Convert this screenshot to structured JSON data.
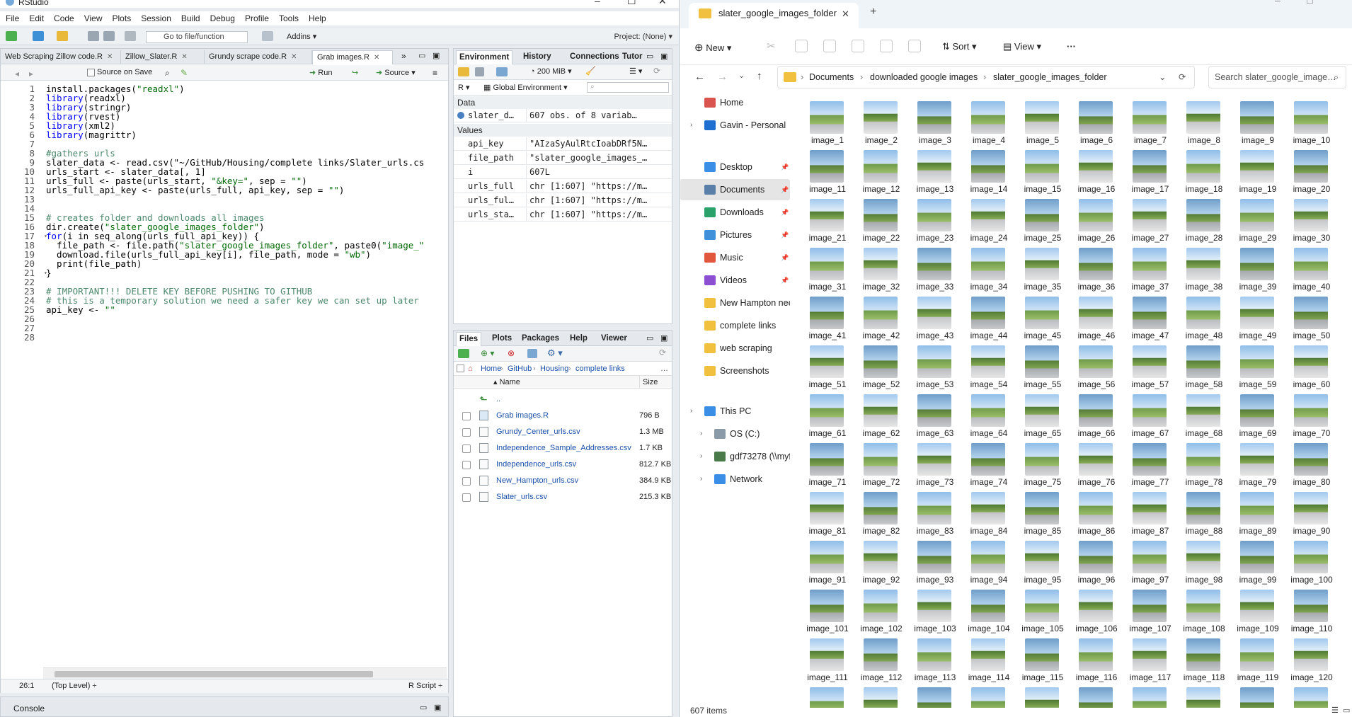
{
  "rstudio": {
    "title": "RStudio",
    "menu": [
      "File",
      "Edit",
      "Code",
      "View",
      "Plots",
      "Session",
      "Build",
      "Debug",
      "Profile",
      "Tools",
      "Help"
    ],
    "goto_file": "Go to file/function",
    "addins": "Addins",
    "project": "Project: (None)",
    "source_tabs": [
      "Web Scraping Zillow code.R",
      "Zillow_Slater.R",
      "Grundy scrape code.R",
      "Grab images.R"
    ],
    "source_on_save": "Source on Save",
    "run": "Run",
    "source": "Source",
    "code_lines": [
      "install.packages(\"readxl\")",
      "library(readxl)",
      "library(stringr)",
      "library(rvest)",
      "library(xml2)",
      "library(magrittr)",
      "",
      "#gathers urls",
      "slater_data <- read.csv(\"~/GitHub/Housing/complete links/Slater_urls.cs",
      "urls_start <- slater_data[, 1]",
      "urls_full <- paste(urls_start, \"&key=\", sep = \"\")",
      "urls_full_api_key <- paste(urls_full, api_key, sep = \"\")",
      "",
      "",
      "# creates folder and downloads all images",
      "dir.create(\"slater_google_images_folder\")",
      "for(i in seq_along(urls_full_api_key)) {",
      "  file_path <- file.path(\"slater_google_images_folder\", paste0(\"image_\"",
      "  download.file(urls_full_api_key[i], file_path, mode = \"wb\")",
      "  print(file_path)",
      "}",
      "",
      "# IMPORTANT!!! DELETE KEY BEFORE PUSHING TO GITHUB",
      "# this is a temporary solution we need a safer key we can set up later",
      "api_key <- \"\"",
      "",
      "",
      ""
    ],
    "status_pos": "26:1",
    "status_scope": "(Top Level) ÷",
    "status_type": "R Script ÷",
    "console": "Console",
    "env_tabs": [
      "Environment",
      "History",
      "Connections",
      "Tutor"
    ],
    "memory": "200 MiB",
    "r_label": "R",
    "global_env": "Global Environment",
    "data_header": "Data",
    "data_rows": [
      {
        "name": "slater_d…",
        "value": "607 obs. of 8 variab…"
      }
    ],
    "values_header": "Values",
    "value_rows": [
      {
        "name": "api_key",
        "value": "\"AIzaSyAulRtcIoabDRf5N…"
      },
      {
        "name": "file_path",
        "value": "\"slater_google_images_…"
      },
      {
        "name": "i",
        "value": "607L"
      },
      {
        "name": "urls_full",
        "value": "chr [1:607] \"https://m…"
      },
      {
        "name": "urls_ful…",
        "value": "chr [1:607] \"https://m…"
      },
      {
        "name": "urls_sta…",
        "value": "chr [1:607] \"https://m…"
      }
    ],
    "file_tabs": [
      "Files",
      "Plots",
      "Packages",
      "Help",
      "Viewer"
    ],
    "breadcrumb": [
      "Home",
      "GitHub",
      "Housing",
      "complete links"
    ],
    "col_name": "Name",
    "col_size": "Size",
    "up": "..",
    "files": [
      {
        "name": "Grab images.R",
        "size": "796 B"
      },
      {
        "name": "Grundy_Center_urls.csv",
        "size": "1.3 MB"
      },
      {
        "name": "Independence_Sample_Addresses.csv",
        "size": "1.7 KB"
      },
      {
        "name": "Independence_urls.csv",
        "size": "812.7 KB"
      },
      {
        "name": "New_Hampton_urls.csv",
        "size": "384.9 KB"
      },
      {
        "name": "Slater_urls.csv",
        "size": "215.3 KB"
      }
    ]
  },
  "explorer": {
    "tab_title": "slater_google_images_folder",
    "new": "New",
    "sort": "Sort",
    "view": "View",
    "more": "···",
    "path": [
      "Documents",
      "downloaded google images",
      "slater_google_images_folder"
    ],
    "search_placeholder": "Search slater_google_image…",
    "nav": [
      {
        "label": "Home",
        "icon": "home-icon",
        "color": "#d9534f"
      },
      {
        "label": "Gavin - Personal",
        "icon": "cloud-icon",
        "color": "#1f6fd1",
        "chev": true
      },
      {
        "label": "Desktop",
        "icon": "desktop-icon",
        "color": "#3a8ee6",
        "pin": true
      },
      {
        "label": "Documents",
        "icon": "documents-icon",
        "color": "#5a7fa8",
        "pin": true,
        "sel": true
      },
      {
        "label": "Downloads",
        "icon": "downloads-icon",
        "color": "#2aa06a",
        "pin": true
      },
      {
        "label": "Pictures",
        "icon": "pictures-icon",
        "color": "#3f8fd9",
        "pin": true
      },
      {
        "label": "Music",
        "icon": "music-icon",
        "color": "#e0573d",
        "pin": true
      },
      {
        "label": "Videos",
        "icon": "videos-icon",
        "color": "#8c4fd1",
        "pin": true
      },
      {
        "label": "New Hampton nee",
        "icon": "folder-icon",
        "color": "#f0c03e"
      },
      {
        "label": "complete links",
        "icon": "folder-icon",
        "color": "#f0c03e"
      },
      {
        "label": "web scraping",
        "icon": "folder-icon",
        "color": "#f0c03e"
      },
      {
        "label": "Screenshots",
        "icon": "folder-icon",
        "color": "#f0c03e"
      },
      {
        "label": "This PC",
        "icon": "pc-icon",
        "color": "#3a8ee6",
        "chev": true
      },
      {
        "label": "OS (C:)",
        "icon": "drive-icon",
        "color": "#8a9aa8",
        "chev": true
      },
      {
        "label": "gdf73278 (\\\\myfil",
        "icon": "network-drive-icon",
        "color": "#4a7a4a",
        "chev": true
      },
      {
        "label": "Network",
        "icon": "network-icon",
        "color": "#3a8ee6",
        "chev": true
      }
    ],
    "image_labels_count": 120,
    "status": "607 items"
  }
}
